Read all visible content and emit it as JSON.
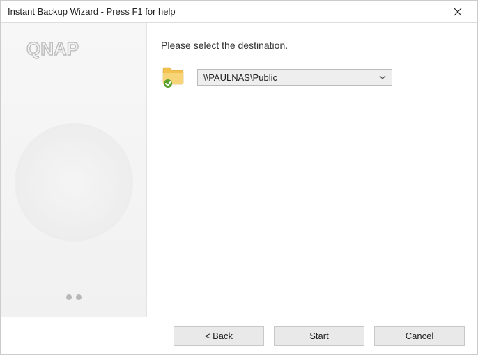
{
  "window": {
    "title": "Instant Backup Wizard - Press F1 for help"
  },
  "sidebar": {
    "brand": "QNAP"
  },
  "main": {
    "instruction": "Please select the destination.",
    "destination": {
      "selected": "\\\\PAULNAS\\Public"
    }
  },
  "footer": {
    "back": "< Back",
    "start": "Start",
    "cancel": "Cancel"
  }
}
